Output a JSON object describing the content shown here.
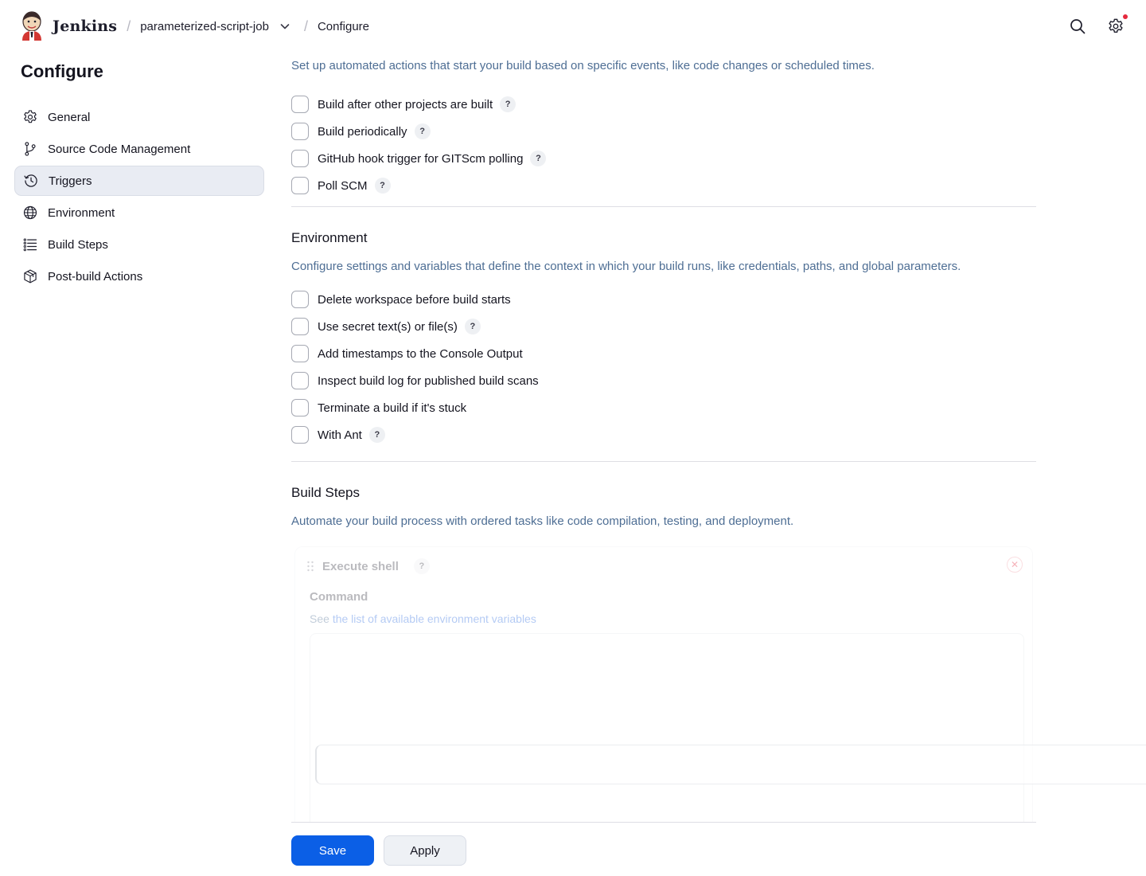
{
  "header": {
    "brand": "Jenkins",
    "breadcrumbs": [
      {
        "label": "parameterized-script-job"
      },
      {
        "label": "Configure"
      }
    ],
    "separator": "/",
    "icons": [
      "jenkins-logo-icon",
      "chevron-down-icon",
      "search-icon",
      "gear-icon"
    ]
  },
  "sidebar": {
    "title": "Configure",
    "items": [
      {
        "label": "General",
        "icon": "gear-icon"
      },
      {
        "label": "Source Code Management",
        "icon": "branch-icon"
      },
      {
        "label": "Triggers",
        "icon": "clock-icon",
        "active": true
      },
      {
        "label": "Environment",
        "icon": "globe-icon"
      },
      {
        "label": "Build Steps",
        "icon": "list-icon"
      },
      {
        "label": "Post-build Actions",
        "icon": "package-icon"
      }
    ]
  },
  "triggers": {
    "description": "Set up automated actions that start your build based on specific events, like code changes or scheduled times.",
    "options": [
      {
        "label": "Build after other projects are built",
        "help": "?"
      },
      {
        "label": "Build periodically",
        "help": "?"
      },
      {
        "label": "GitHub hook trigger for GITScm polling",
        "help": "?"
      },
      {
        "label": "Poll SCM",
        "help": "?"
      }
    ]
  },
  "environment": {
    "title": "Environment",
    "description": "Configure settings and variables that define the context in which your build runs, like credentials, paths, and global parameters.",
    "options": [
      {
        "label": "Delete workspace before build starts"
      },
      {
        "label": "Use secret text(s) or file(s)",
        "help": "?"
      },
      {
        "label": "Add timestamps to the Console Output"
      },
      {
        "label": "Inspect build log for published build scans"
      },
      {
        "label": "Terminate a build if it's stuck"
      },
      {
        "label": "With Ant",
        "help": "?"
      }
    ]
  },
  "build_steps": {
    "title": "Build Steps",
    "description": "Automate your build process with ordered tasks like code compilation, testing, and deployment.",
    "step": {
      "name": "Execute shell",
      "help": "?",
      "command_label": "Command",
      "note_prefix": "See ",
      "note_link": "the list of available environment variables"
    }
  },
  "actions": {
    "save": "Save",
    "apply": "Apply"
  },
  "colors": {
    "primary": "#0b5fe6",
    "description_text": "#4e6e94",
    "active_nav_bg": "#e9ecf3",
    "notification": "#e5293d"
  }
}
